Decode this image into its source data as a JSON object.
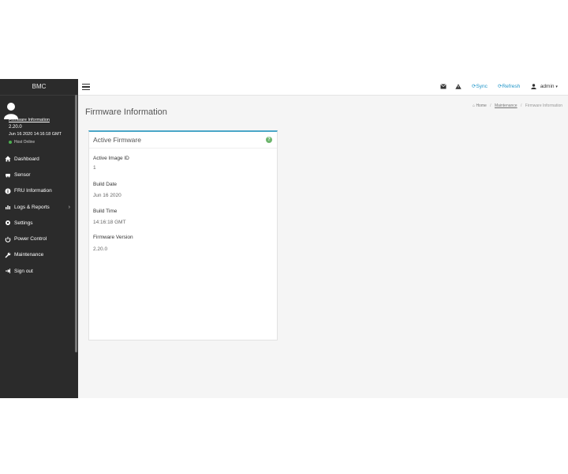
{
  "sidebar": {
    "brand": "BMC",
    "user": {
      "link_label": "Firmware Information",
      "firmware_version": "2.20.0",
      "build_datetime": "Jun 16 2020 14:16:18 GMT",
      "host_status": "Host Online"
    },
    "items": [
      {
        "label": "Dashboard",
        "icon": "home-icon"
      },
      {
        "label": "Sensor",
        "icon": "sensor-icon"
      },
      {
        "label": "FRU Information",
        "icon": "info-icon"
      },
      {
        "label": "Logs & Reports",
        "icon": "chart-icon"
      },
      {
        "label": "Settings",
        "icon": "gear-icon"
      },
      {
        "label": "Power Control",
        "icon": "power-icon"
      },
      {
        "label": "Maintenance",
        "icon": "wrench-icon"
      },
      {
        "label": "Sign out",
        "icon": "sign-out-icon"
      }
    ]
  },
  "topbar": {
    "sync_label": "Sync",
    "refresh_label": "Refresh",
    "user_label": "admin"
  },
  "page": {
    "title": "Firmware Information",
    "breadcrumb": [
      "Home",
      "Maintenance",
      "Firmware Information"
    ]
  },
  "panel": {
    "title": "Active Firmware",
    "fields": [
      {
        "label": "Active Image ID",
        "value": "1"
      },
      {
        "label": "Build Date",
        "value": "Jun 16 2020"
      },
      {
        "label": "Build Time",
        "value": "14:16:18 GMT"
      },
      {
        "label": "Firmware Version",
        "value": "2.20.0"
      }
    ]
  },
  "colors": {
    "sidebar_bg": "#2b2b2b",
    "content_bg": "#f5f5f5",
    "accent_blue": "#2196c9",
    "panel_border_top": "#4aa7c8",
    "status_green": "#4caf50"
  }
}
